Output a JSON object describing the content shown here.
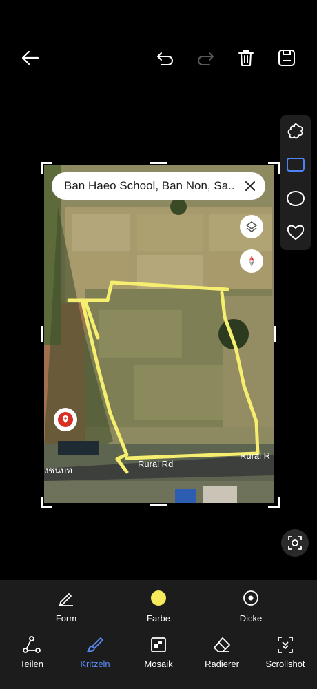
{
  "toolbar": {
    "back_icon": "arrow-left-icon",
    "undo_icon": "undo-icon",
    "redo_icon": "redo-icon",
    "delete_icon": "trash-icon",
    "save_icon": "save-icon"
  },
  "shapes": {
    "items": [
      "freeform-blob-icon",
      "rectangle-icon",
      "circle-icon",
      "heart-icon"
    ],
    "selected": "rectangle-icon",
    "accent": "#4f83f1"
  },
  "map": {
    "search_text": "Ban Haeo School, Ban Non, Sa...",
    "road_label_right": "Rural R",
    "road_label_center": "Rural Rd",
    "road_label_left": "งชนบท",
    "stroke_color": "#f5ee6e"
  },
  "options": {
    "form": "Form",
    "color": "Farbe",
    "thickness": "Dicke",
    "selected_color": "#f6ea5c"
  },
  "tools": {
    "share": "Teilen",
    "scribble": "Kritzeln",
    "mosaic": "Mosaik",
    "eraser": "Radierer",
    "scrollshot": "Scrollshot",
    "active": "Kritzeln",
    "active_color": "#5b8df6"
  }
}
